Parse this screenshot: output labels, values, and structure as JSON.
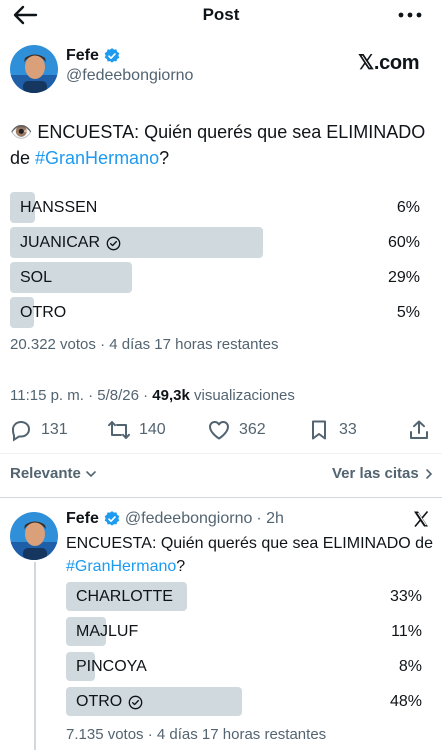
{
  "topbar": {
    "title": "Post"
  },
  "tweet": {
    "name": "Fefe",
    "handle": "@fedeebongiorno",
    "source": "𝕏.com",
    "text_emoji": "👁️",
    "text_main": " ENCUESTA: Quién querés que sea ELIMINADO de ",
    "text_hashtag": "#GranHermano",
    "text_end": "?",
    "poll": [
      {
        "label": "HANSSEN",
        "percent": 6,
        "percent_text": "6%",
        "winner": false
      },
      {
        "label": "JUANICAR",
        "percent": 60,
        "percent_text": "60%",
        "winner": true
      },
      {
        "label": "SOL",
        "percent": 29,
        "percent_text": "29%",
        "winner": false
      },
      {
        "label": "OTRO",
        "percent": 5,
        "percent_text": "5%",
        "winner": false
      }
    ],
    "poll_meta": "20.322 votos · 4 días 17 horas restantes",
    "timestamp": "11:15 p. m. · 5/8/26 · ",
    "views_count": "49,3k",
    "views_label": " visualizaciones",
    "actions": {
      "replies": "131",
      "reposts": "140",
      "likes": "362",
      "bookmarks": "33"
    }
  },
  "filters": {
    "sort_label": "Relevante",
    "quotes_label": "Ver las citas"
  },
  "quote": {
    "name": "Fefe",
    "handle": "@fedeebongiorno",
    "time": "· 2h",
    "text_main": "ENCUESTA: Quién querés que sea ELIMINADO de ",
    "text_hashtag": "#GranHermano",
    "text_end": "?",
    "poll": [
      {
        "label": "CHARLOTTE",
        "percent": 33,
        "percent_text": "33%",
        "winner": false
      },
      {
        "label": "MAJLUF",
        "percent": 11,
        "percent_text": "11%",
        "winner": false
      },
      {
        "label": "PINCOYA",
        "percent": 8,
        "percent_text": "8%",
        "winner": false
      },
      {
        "label": "OTRO",
        "percent": 48,
        "percent_text": "48%",
        "winner": true
      }
    ],
    "poll_meta": "7.135 votos · 4 días 17 horas restantes"
  },
  "colors": {
    "accent": "#1d9bf0",
    "bar": "#cfd9de",
    "muted": "#536471",
    "text": "#0f1419"
  }
}
